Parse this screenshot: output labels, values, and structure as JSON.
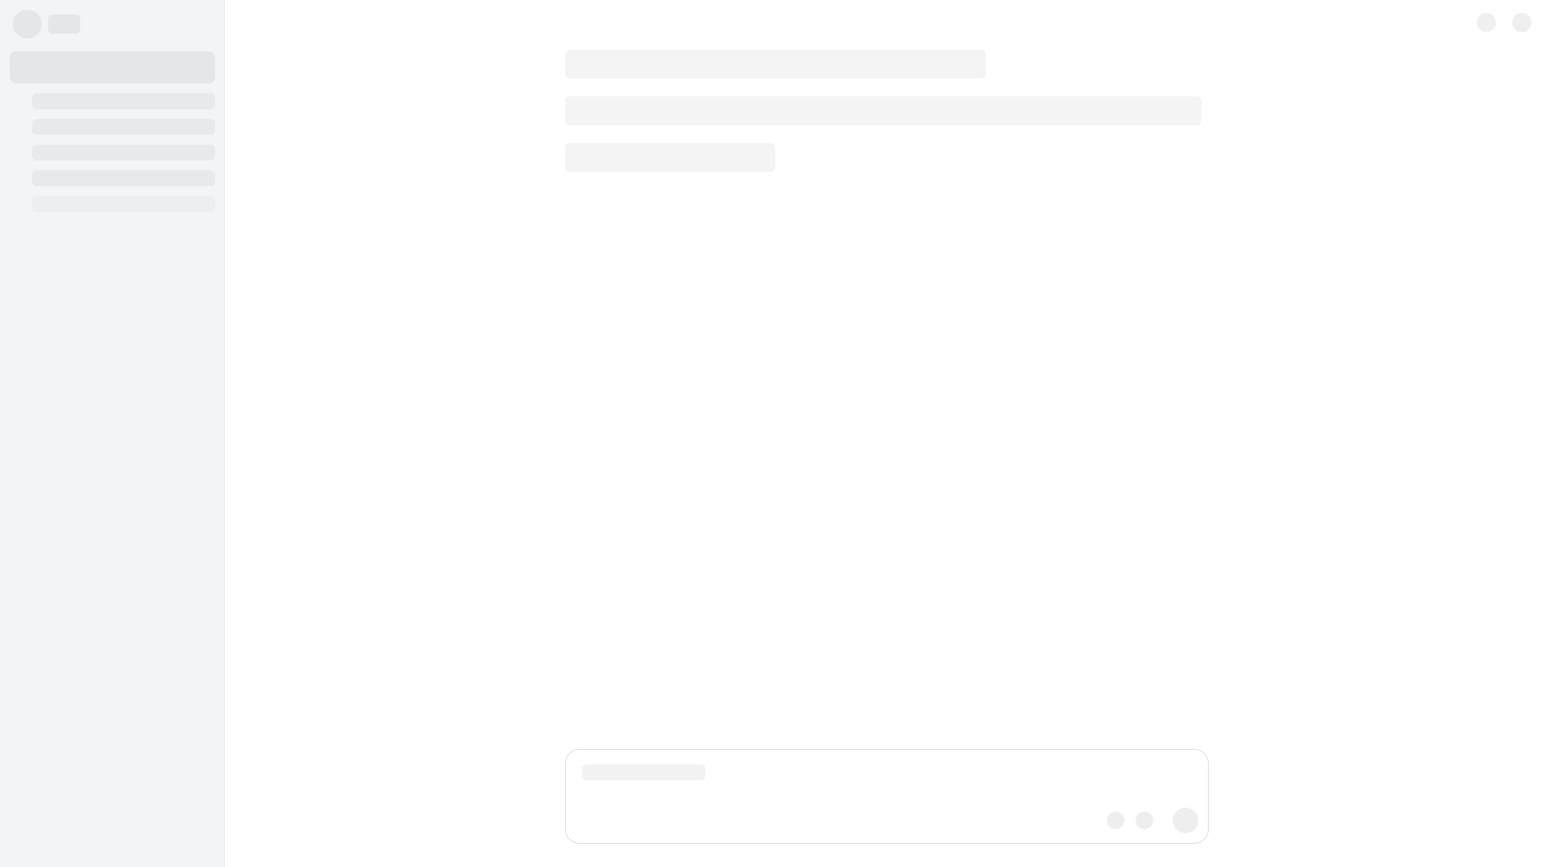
{
  "app": {
    "state": "loading-skeleton",
    "colors": {
      "sidebar_bg": "#f3f4f6",
      "skeleton": "#e5e6e9",
      "skeleton_light": "#f4f4f4",
      "border": "#dcdcdc"
    }
  },
  "sidebar": {
    "avatar_icon": "avatar-placeholder",
    "items_count_hint": "skeleton"
  },
  "header": {
    "actions": [
      {
        "icon": "placeholder-circle"
      },
      {
        "icon": "placeholder-circle"
      }
    ]
  },
  "composer": {
    "placeholder": "",
    "tools": [
      {
        "icon": "placeholder-circle"
      },
      {
        "icon": "placeholder-circle"
      },
      {
        "icon": "send-placeholder"
      }
    ]
  }
}
